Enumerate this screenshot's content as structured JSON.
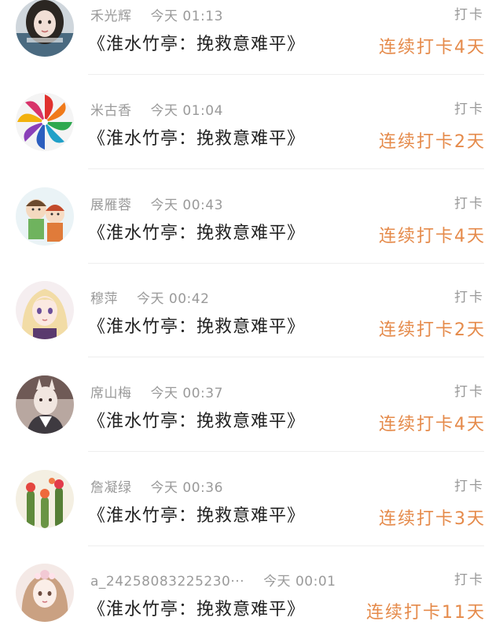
{
  "feed": {
    "items": [
      {
        "user": "禾光辉",
        "time": "今天 01:13",
        "title": "《淮水竹亭：挽救意难平》",
        "tag": "打卡",
        "streak": "连续打卡4天",
        "avatar": "avatar-girl-dark-hair"
      },
      {
        "user": "米古香",
        "time": "今天 01:04",
        "title": "《淮水竹亭：挽救意难平》",
        "tag": "打卡",
        "streak": "连续打卡2天",
        "avatar": "avatar-pinwheel"
      },
      {
        "user": "展雁蓉",
        "time": "今天 00:43",
        "title": "《淮水竹亭：挽救意难平》",
        "tag": "打卡",
        "streak": "连续打卡4天",
        "avatar": "avatar-anime-kids"
      },
      {
        "user": "穆萍",
        "time": "今天 00:42",
        "title": "《淮水竹亭：挽救意难平》",
        "tag": "打卡",
        "streak": "连续打卡2天",
        "avatar": "avatar-anime-girl-blonde"
      },
      {
        "user": "席山梅",
        "time": "今天 00:37",
        "title": "《淮水竹亭：挽救意难平》",
        "tag": "打卡",
        "streak": "连续打卡4天",
        "avatar": "avatar-mask-figure"
      },
      {
        "user": "詹凝绿",
        "time": "今天 00:36",
        "title": "《淮水竹亭：挽救意难平》",
        "tag": "打卡",
        "streak": "连续打卡3天",
        "avatar": "avatar-cactus-flowers"
      },
      {
        "user": "a_24258083225230···",
        "time": "今天 00:01",
        "title": "《淮水竹亭：挽救意难平》",
        "tag": "打卡",
        "streak": "连续打卡11天",
        "avatar": "avatar-doll-girl"
      }
    ]
  },
  "colors": {
    "streak": "#e58a4a",
    "meta": "#9a9a9a",
    "title": "#222222",
    "divider": "#eeeeee"
  }
}
